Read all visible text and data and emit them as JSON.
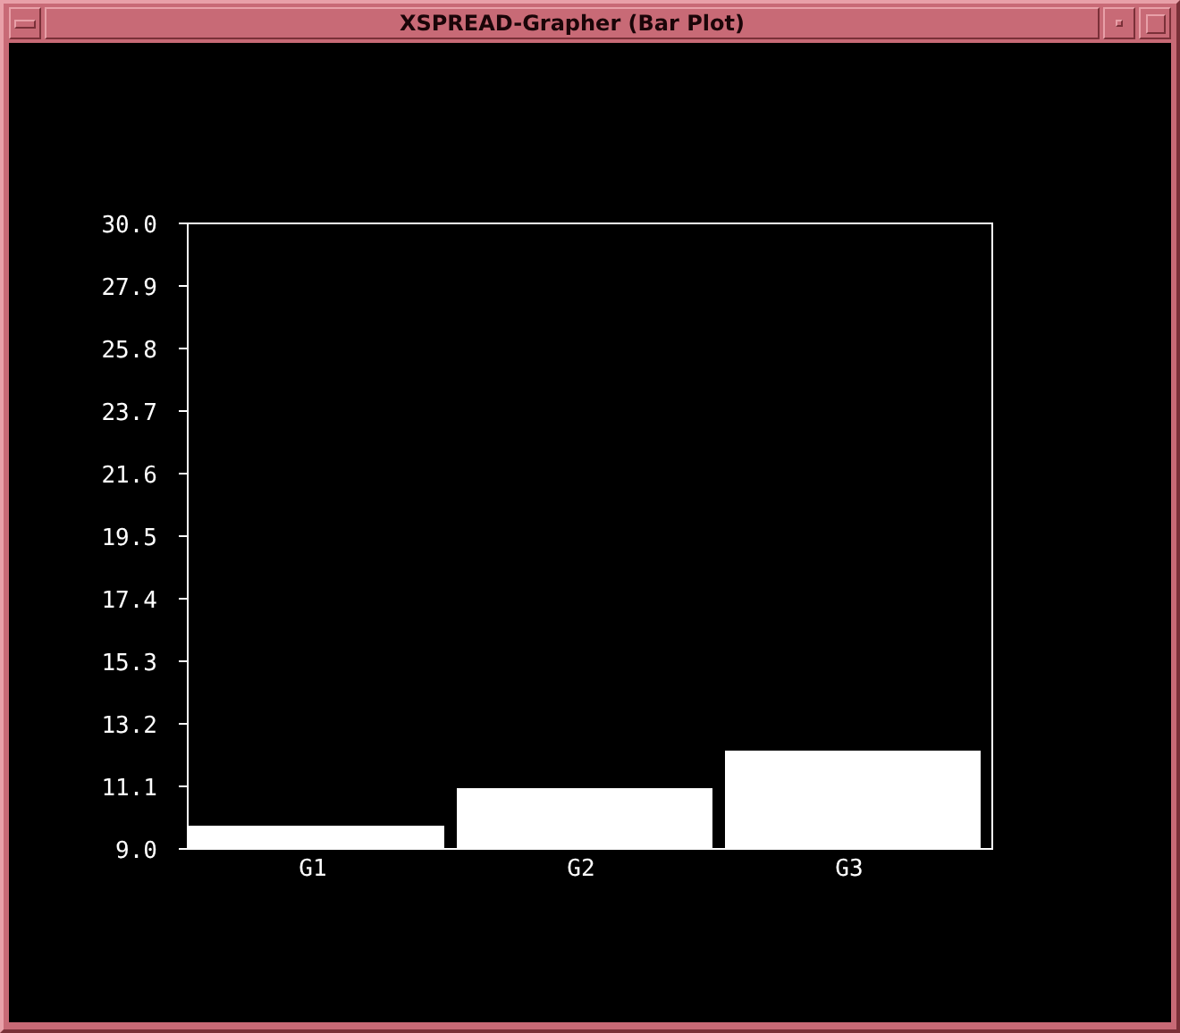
{
  "window": {
    "title": "XSPREAD-Grapher (Bar Plot)"
  },
  "chart_data": {
    "type": "bar",
    "categories": [
      "G1",
      "G2",
      "G3"
    ],
    "values": [
      9.78,
      11.04,
      12.3
    ],
    "ylim": [
      9.0,
      30.0
    ],
    "yticks": [
      {
        "value": 9.0,
        "label": "9.0"
      },
      {
        "value": 11.1,
        "label": "11.1"
      },
      {
        "value": 13.2,
        "label": "13.2"
      },
      {
        "value": 15.3,
        "label": "15.3"
      },
      {
        "value": 17.4,
        "label": "17.4"
      },
      {
        "value": 19.5,
        "label": "19.5"
      },
      {
        "value": 21.6,
        "label": "21.6"
      },
      {
        "value": 23.7,
        "label": "23.7"
      },
      {
        "value": 25.8,
        "label": "25.8"
      },
      {
        "value": 27.9,
        "label": "27.9"
      },
      {
        "value": 30.0,
        "label": "30.0"
      }
    ]
  }
}
